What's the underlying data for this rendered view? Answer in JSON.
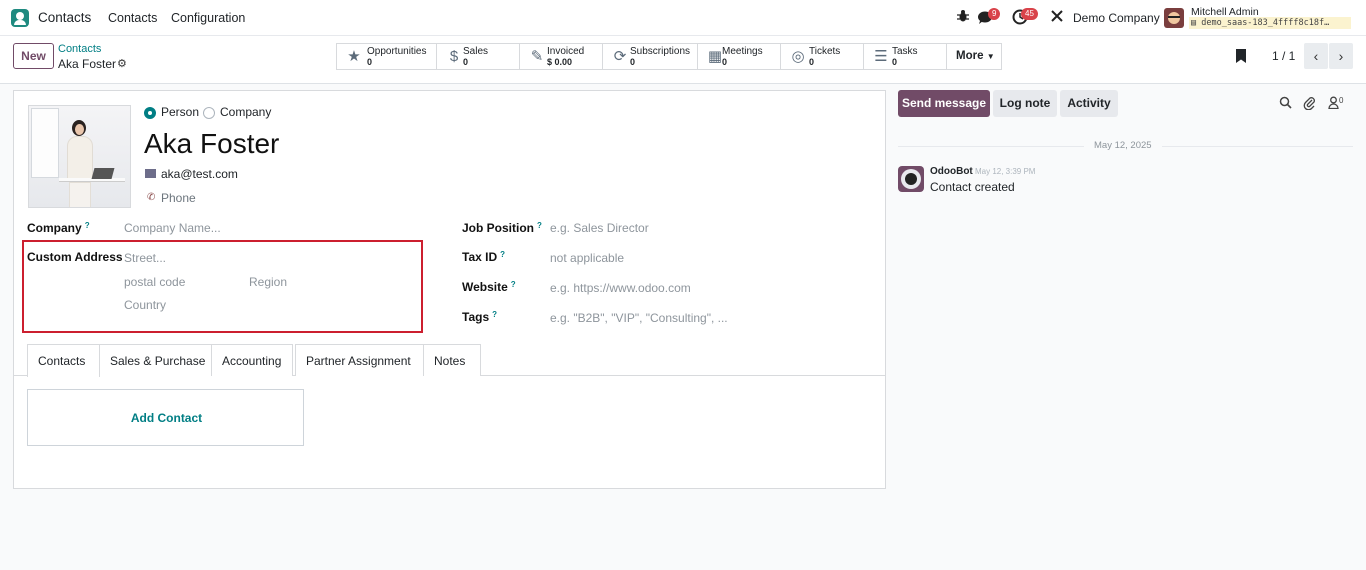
{
  "navbar": {
    "app_name": "Contacts",
    "menus": [
      "Contacts",
      "Configuration"
    ],
    "messages_badge": "9",
    "activities_badge": "45",
    "company": "Demo Company",
    "user_name": "Mitchell Admin",
    "db_name": "demo_saas-183_4ffff8c18f…"
  },
  "control_panel": {
    "new_label": "New",
    "breadcrumb_parent": "Contacts",
    "breadcrumb_current": "Aka Foster",
    "smart_buttons": [
      {
        "label": "Opportunities",
        "value": "0",
        "icon": "star-icon"
      },
      {
        "label": "Sales",
        "value": "0",
        "icon": "dollar-icon"
      },
      {
        "label": "Invoiced",
        "value": "$ 0.00",
        "icon": "invoice-icon"
      },
      {
        "label": "Subscriptions",
        "value": "0",
        "icon": "refresh-icon"
      },
      {
        "label": "Meetings",
        "value": "0",
        "icon": "calendar-icon"
      },
      {
        "label": "Tickets",
        "value": "0",
        "icon": "lifebuoy-icon"
      },
      {
        "label": "Tasks",
        "value": "0",
        "icon": "tasks-icon"
      }
    ],
    "more_label": "More",
    "pager": "1 / 1"
  },
  "form": {
    "type_options": [
      "Person",
      "Company"
    ],
    "selected_type": "Person",
    "name": "Aka Foster",
    "email": "aka@test.com",
    "phone_placeholder": "Phone",
    "company_label": "Company",
    "company_placeholder": "Company Name...",
    "address_label": "Custom Address",
    "street_placeholder": "Street...",
    "postal_placeholder": "postal code",
    "region_placeholder": "Region",
    "country_placeholder": "Country",
    "job_label": "Job Position",
    "job_placeholder": "e.g. Sales Director",
    "taxid_label": "Tax ID",
    "taxid_value": "not applicable",
    "website_label": "Website",
    "website_placeholder": "e.g. https://www.odoo.com",
    "tags_label": "Tags",
    "tags_placeholder": "e.g. \"B2B\", \"VIP\", \"Consulting\", ...",
    "help_marker": "?",
    "tabs": [
      "Contacts",
      "Sales & Purchase",
      "Accounting",
      "Partner Assignment",
      "Notes"
    ],
    "active_tab": "Contacts",
    "add_contact_label": "Add Contact",
    "highlight_color": "#cc1f2f"
  },
  "chatter": {
    "send_message": "Send message",
    "log_note": "Log note",
    "activity": "Activity",
    "followers_count": "0",
    "date_separator": "May 12, 2025",
    "message": {
      "author": "OdooBot",
      "time": "May 12, 3:39 PM",
      "body": "Contact created"
    }
  },
  "colors": {
    "brand_primary": "#714b67",
    "link": "#017e84",
    "badge": "#d9434a"
  }
}
